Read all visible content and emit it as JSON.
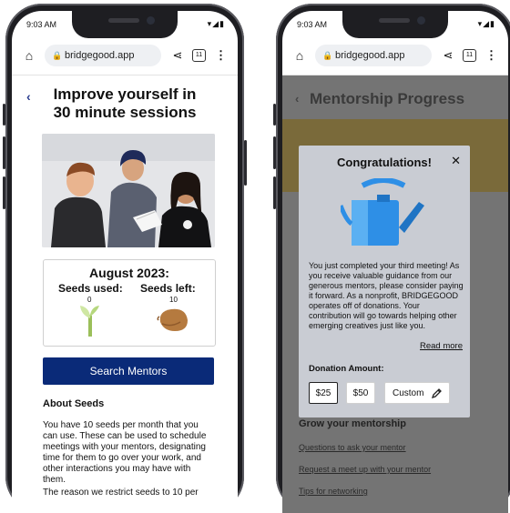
{
  "left_phone": {
    "status": {
      "time": "9:03 AM",
      "icons": "▾◢▮"
    },
    "browser": {
      "url": "bridgegood.app",
      "tab_count": "11",
      "home_icon": "home-icon",
      "share_icon": "share-icon",
      "menu_icon": "menu-icon"
    },
    "page": {
      "back_icon": "‹",
      "heading": "Improve yourself in 30 minute sessions",
      "seeds_card": {
        "title": "August 2023:",
        "used_label": "Seeds used:",
        "used_value": "0",
        "left_label": "Seeds left:",
        "left_value": "10"
      },
      "search_button": "Search Mentors",
      "about_heading": "About Seeds",
      "about_text": "You have 10 seeds per month that you can use. These can be used to schedule meetings with your mentors, designating time for them to go over your work, and other interactions you may have with them.",
      "about_text_cut": "The reason we restrict seeds to 10 per"
    }
  },
  "right_phone": {
    "status": {
      "time": "9:03 AM",
      "icons": "▾◢▮"
    },
    "browser": {
      "url": "bridgegood.app",
      "tab_count": "11"
    },
    "page": {
      "back_icon": "‹",
      "heading": "Mentorship Progress",
      "section_heading": "Grow your mentorship",
      "links": [
        "Questions to ask your mentor",
        "Request a meet up with your mentor",
        "Tips for networking"
      ]
    },
    "modal": {
      "title": "Congratulations!",
      "close_icon": "✕",
      "body": "You just completed your third meeting! As you receive valuable guidance from our generous mentors, please consider paying it forward. As a nonprofit, BRIDGEGOOD operates off of donations. Your contribution will go towards helping other emerging creatives just like you.",
      "read_more": "Read more",
      "donation_label": "Donation Amount:",
      "amounts": [
        "$25",
        "$50",
        "Custom"
      ],
      "selected_amount": "$25",
      "edit_icon": "pencil-icon"
    }
  },
  "colors": {
    "primary_button": "#0a2a78",
    "link": "#2a3d8f",
    "watering_can": "#2e8fe6"
  }
}
